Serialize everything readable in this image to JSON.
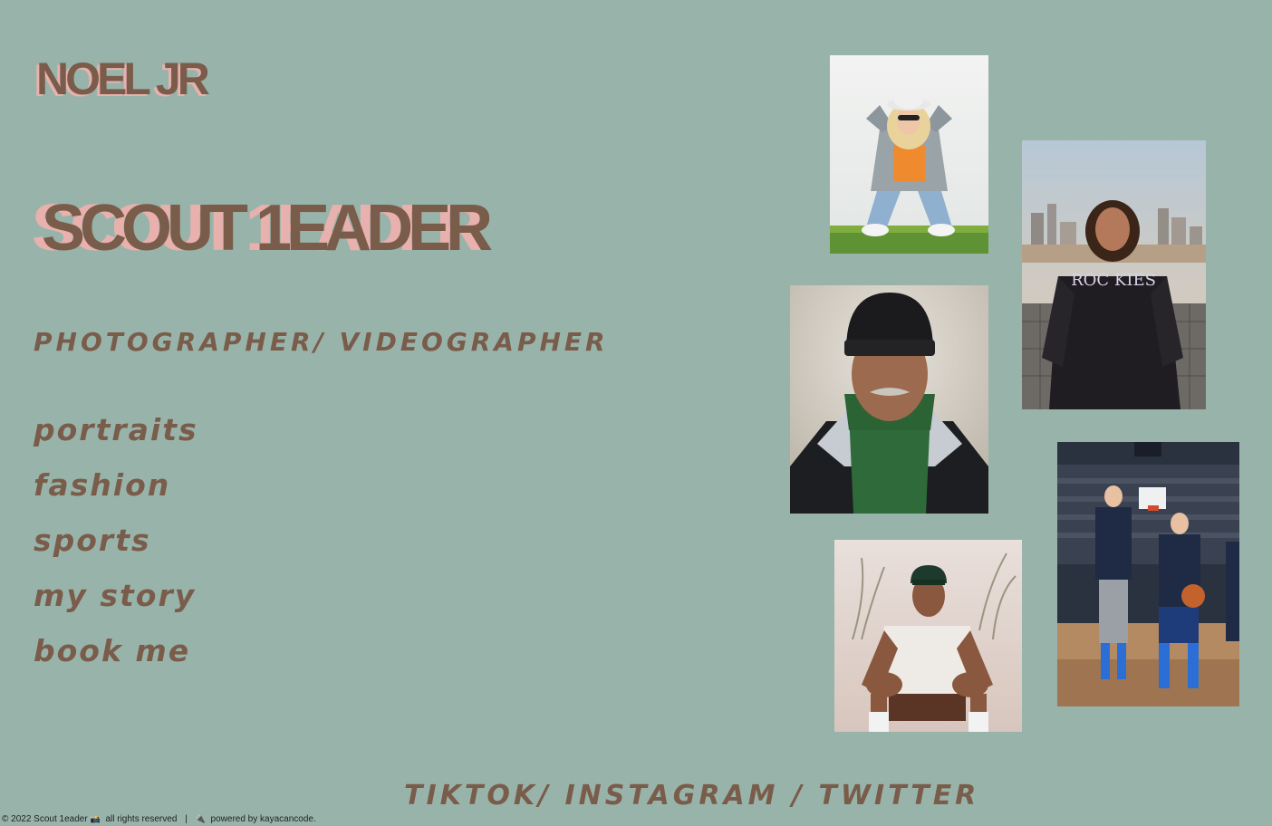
{
  "brand": {
    "name": "NOEL JR",
    "title": "SCOUT 1EADER",
    "role": "PHOTOGRAPHER/ VIDEOGRAPHER"
  },
  "nav": {
    "items": [
      {
        "label": "portraits"
      },
      {
        "label": "fashion"
      },
      {
        "label": "sports"
      },
      {
        "label": "my story"
      },
      {
        "label": "book me"
      }
    ]
  },
  "social": {
    "label": "TIKTOK/ INSTAGRAM / TWITTER"
  },
  "footer": {
    "copyright": "© 2022 Scout 1eader",
    "rights": "all rights reserved",
    "separator": "|",
    "powered": "powered by kayacancode."
  },
  "gallery": {
    "photos": [
      {
        "id": "photo-1",
        "subject": "woman in bucket hat sitting on grass"
      },
      {
        "id": "photo-2",
        "subject": "woman in Rockies jacket with city skyline"
      },
      {
        "id": "photo-3",
        "subject": "man in beanie and green hoodie portrait"
      },
      {
        "id": "photo-4",
        "subject": "basketball players on court"
      },
      {
        "id": "photo-5",
        "subject": "man in cap sitting with grass behind"
      }
    ]
  },
  "colors": {
    "background": "#98b4aa",
    "text": "#7a5c4b",
    "accent_shadow": "#e8b1ae"
  }
}
